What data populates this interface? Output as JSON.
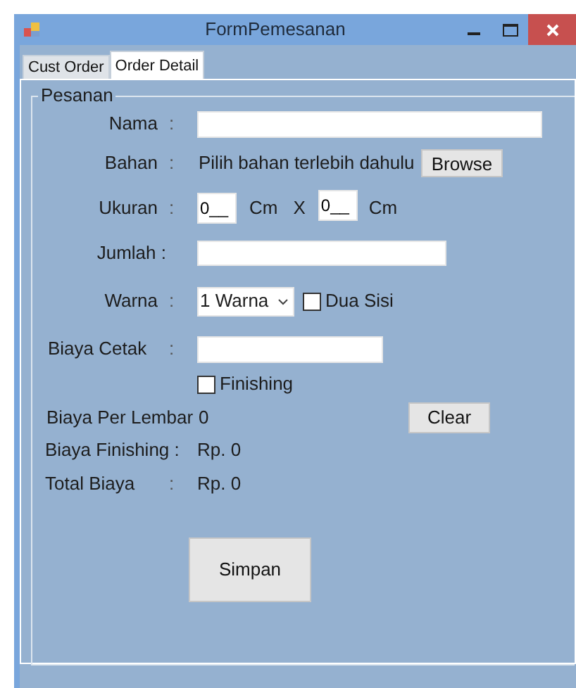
{
  "window": {
    "title": "FormPemesanan"
  },
  "tabs": [
    {
      "label": "Cust Order",
      "selected": false
    },
    {
      "label": "Order Detail",
      "selected": true
    }
  ],
  "group": {
    "title": "Pesanan"
  },
  "nama": {
    "label": "Nama",
    "colon": ":"
  },
  "bahan": {
    "label": "Bahan",
    "colon": ":",
    "text": "Pilih bahan terlebih dahulu",
    "button": "Browse"
  },
  "ukuran": {
    "label": "Ukuran",
    "colon": ":",
    "width_value": "0__",
    "unit_1": "Cm",
    "separator": "X",
    "height_value": "0__",
    "unit_2": "Cm"
  },
  "jumlah": {
    "label": "Jumlah :"
  },
  "warna": {
    "label": "Warna",
    "colon": ":",
    "select": "1 Warna",
    "dua_sisi": {
      "label": "Dua Sisi",
      "checked": false
    }
  },
  "biaya_cetak": {
    "label": "Biaya Cetak",
    "colon": ":"
  },
  "finishing": {
    "label": "Finishing",
    "checked": false
  },
  "biaya_per_lembar": {
    "label": "Biaya Per Lembar",
    "value": "0"
  },
  "clear_button": "Clear",
  "biaya_finishing": {
    "label": "Biaya Finishing :",
    "value": "Rp. 0"
  },
  "total_biaya": {
    "label": "Total Biaya",
    "colon": ":",
    "value": "Rp. 0"
  },
  "save_button": "Simpan"
}
